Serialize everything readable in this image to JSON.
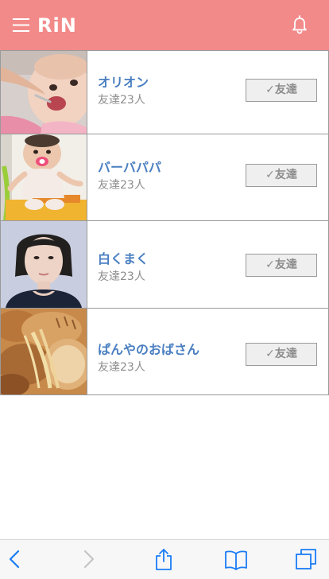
{
  "header": {
    "logo_text": "RiN",
    "background_color": "#f38a8a",
    "menu_icon": "hamburger-menu-icon",
    "notification_icon": "bell-icon"
  },
  "friends": [
    {
      "name": "オリオン",
      "count": "友達23人",
      "button_label": "✓友達",
      "thumbnail": "baby-eating-photo"
    },
    {
      "name": "バーバパパ",
      "count": "友達23人",
      "button_label": "✓友達",
      "thumbnail": "baby-with-pacifier-photo"
    },
    {
      "name": "白くまく",
      "count": "友達23人",
      "button_label": "✓友達",
      "thumbnail": "woman-portrait-photo"
    },
    {
      "name": "ぱんやのおばさん",
      "count": "友達23人",
      "button_label": "✓友達",
      "thumbnail": "bread-loaves-photo"
    }
  ],
  "colors": {
    "accent": "#f38a8a",
    "name_text": "#4a7fc1",
    "muted_text": "#8c8c8c",
    "browser_icon": "#1a7cf5"
  },
  "browser_toolbar": {
    "icons": [
      "back-icon",
      "forward-icon",
      "share-icon",
      "bookmarks-icon",
      "tabs-icon"
    ]
  }
}
